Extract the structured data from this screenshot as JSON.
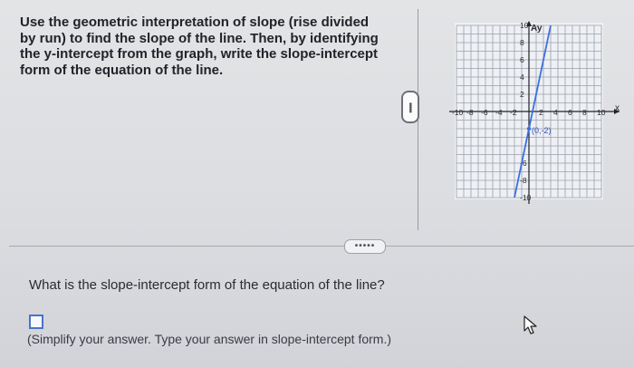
{
  "question": {
    "lines": [
      "Use the geometric interpretation of slope (rise divided",
      "by run) to find the slope of the line. Then, by identifying",
      "the y-intercept from the graph, write the slope-intercept",
      "form of the equation of the line."
    ]
  },
  "graph": {
    "axis_x_label": "x",
    "axis_y_label": "Ay",
    "x_ticks": [
      "-10",
      "-8",
      "-6",
      "-4",
      "-2",
      "2",
      "4",
      "6",
      "8",
      "10"
    ],
    "y_ticks": [
      "10",
      "8",
      "6",
      "4",
      "2",
      "-6",
      "-8",
      "-10"
    ],
    "point_label": "(0,-2)",
    "line_color": "#3b6fe0",
    "grid_color": "#9aa0ab",
    "line_points": [
      {
        "x": -2,
        "y": -10
      },
      {
        "x": 3,
        "y": 10
      }
    ]
  },
  "answer": {
    "prompt": "What is the slope-intercept form of the equation of the line?",
    "hint": "(Simplify your answer. Type your answer in slope-intercept form.)"
  },
  "controls": {
    "more_vertical": "•••••",
    "more_horizontal": "•••••"
  }
}
